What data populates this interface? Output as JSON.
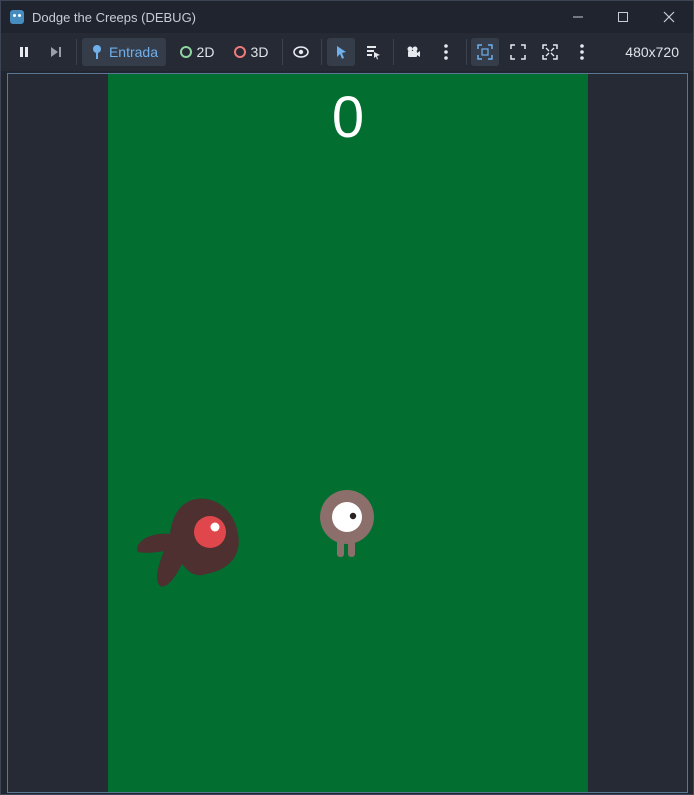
{
  "window": {
    "title": "Dodge the Creeps (DEBUG)",
    "controls": {
      "minimize": "minimize-icon",
      "maximize": "maximize-icon",
      "close": "close-icon"
    }
  },
  "toolbar": {
    "pause_icon": "pause-icon",
    "step_icon": "next-frame-icon",
    "input_label": "Entrada",
    "mode_2d_label": "2D",
    "mode_3d_label": "3D",
    "resolution": "480x720",
    "colors": {
      "input_active": "#6fb0ec",
      "ring_2d": "#8ed5a0",
      "ring_3d": "#f07a7a"
    }
  },
  "game": {
    "score": "0",
    "background": "#026e30",
    "player": {
      "name": "player",
      "body_color": "#8c6f6a"
    },
    "mob": {
      "name": "mob",
      "body_color": "#4d302f",
      "eye_color": "#e0474c"
    }
  }
}
